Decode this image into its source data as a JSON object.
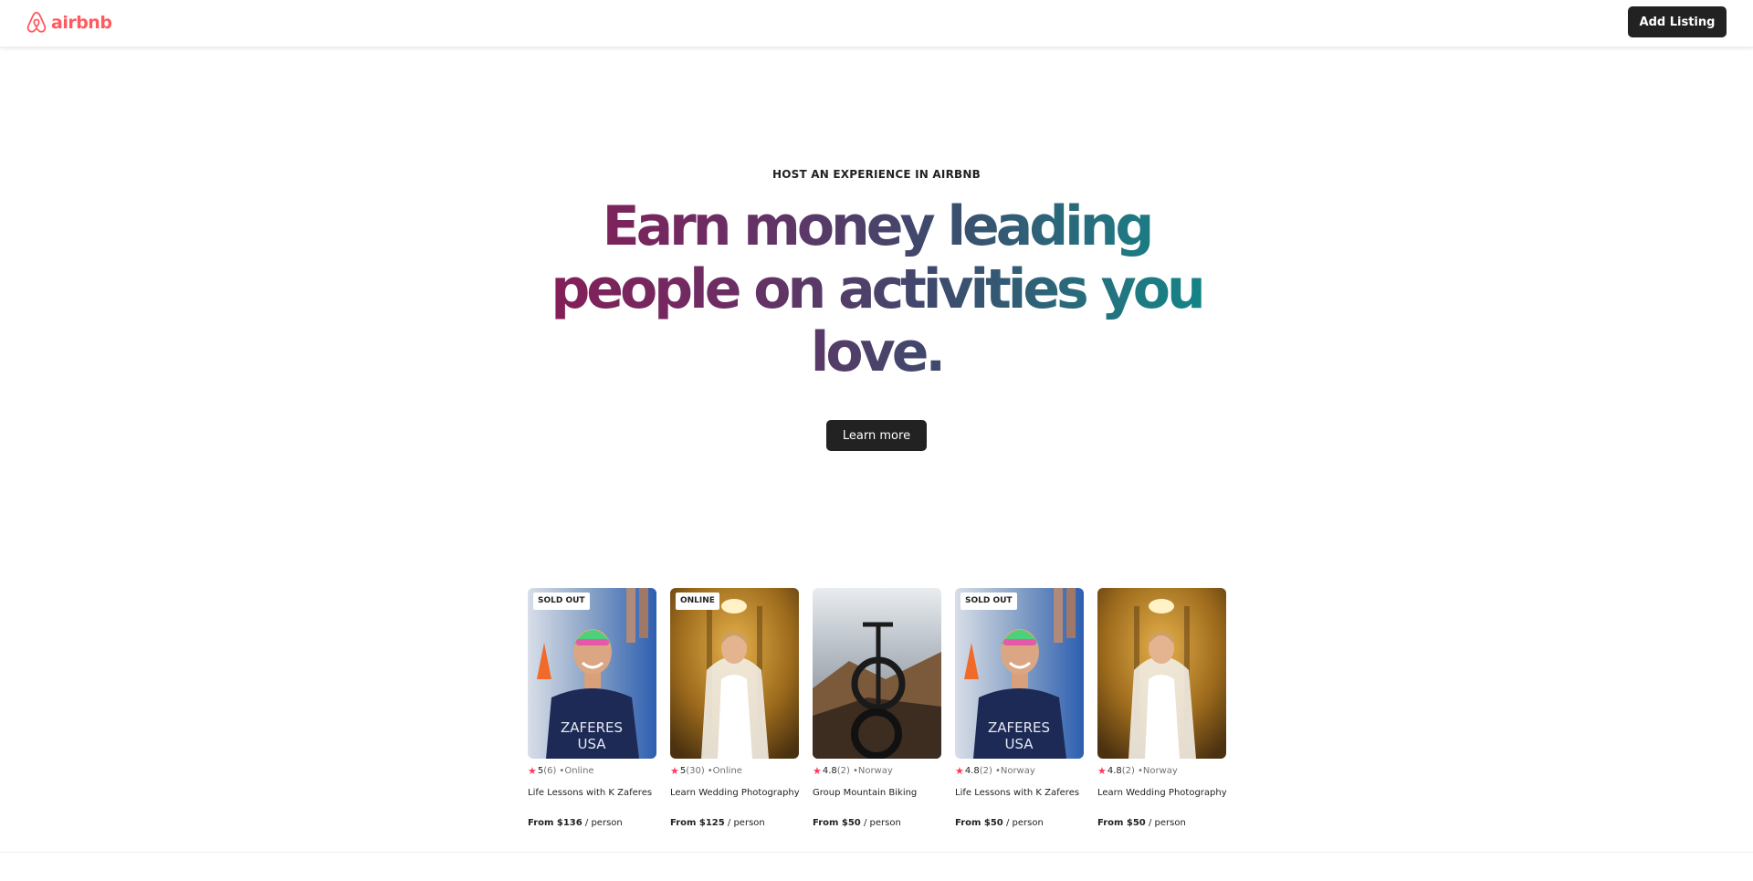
{
  "header": {
    "logo_text": "airbnb",
    "add_listing_label": "Add Listing",
    "brand_color": "#ff5a5f"
  },
  "hero": {
    "eyebrow": "HOST AN EXPERIENCE IN AIRBNB",
    "headline": "Earn money leading people on activities you love.",
    "cta_label": "Learn more"
  },
  "cards": [
    {
      "badge": "SOLD OUT",
      "rating": "5",
      "reviews": "(6)",
      "location": "•Online",
      "title": "Life Lessons with K Zaferes",
      "price": "From $136",
      "per": " / person",
      "image": "swimmer-photo"
    },
    {
      "badge": "ONLINE",
      "rating": "5",
      "reviews": "(30)",
      "location": "•Online",
      "title": "Learn Wedding Photography",
      "price": "From $125",
      "per": " / person",
      "image": "bride-photo"
    },
    {
      "badge": "",
      "rating": "4.8",
      "reviews": "(2)",
      "location": "•Norway",
      "title": "Group Mountain Biking",
      "price": "From $50",
      "per": " / person",
      "image": "mountain-bike-photo"
    },
    {
      "badge": "SOLD OUT",
      "rating": "4.8",
      "reviews": "(2)",
      "location": "•Norway",
      "title": "Life Lessons with K Zaferes",
      "price": "From $50",
      "per": " / person",
      "image": "swimmer-photo"
    },
    {
      "badge": "",
      "rating": "4.8",
      "reviews": "(2)",
      "location": "•Norway",
      "title": "Learn Wedding Photography",
      "price": "From $50",
      "per": " / person",
      "image": "bride-photo"
    }
  ],
  "icons": {
    "star": "★",
    "star_color": "#ff385c"
  }
}
